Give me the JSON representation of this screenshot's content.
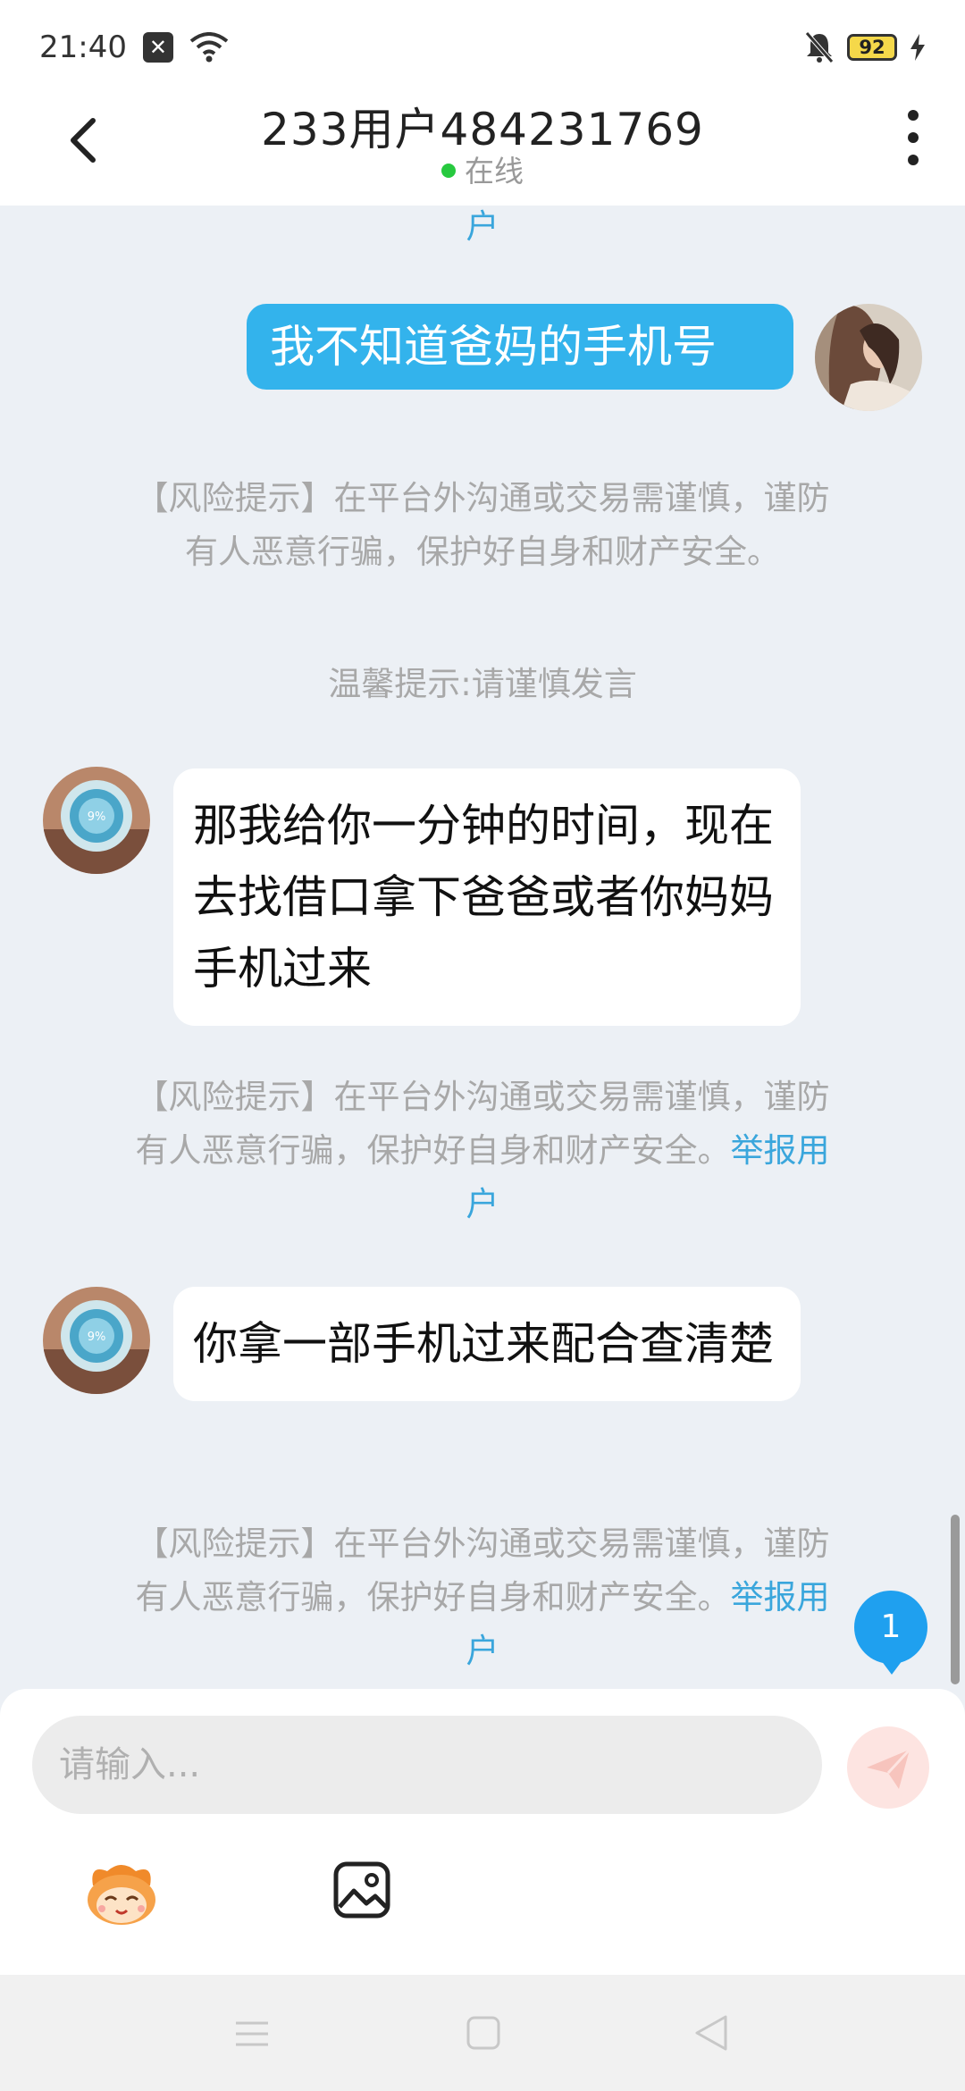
{
  "status_bar": {
    "time": "21:40",
    "battery": "92",
    "icons": [
      "close-box-icon",
      "wifi-icon",
      "mute-bell-icon",
      "battery-icon",
      "charging-icon"
    ]
  },
  "header": {
    "title": "233用户484231769",
    "status": "在线",
    "status_color": "#27c93f"
  },
  "chat": {
    "top_fragment": "户",
    "messages": [
      {
        "sender": "me",
        "text": "我不知道爸妈的手机号"
      },
      {
        "sender": "other",
        "text": "那我给你一分钟的时间，现在去找借口拿下爸爸或者你妈妈手机过来"
      },
      {
        "sender": "other",
        "text": "你拿一部手机过来配合查清楚"
      }
    ],
    "risk_notice_line1": "【风险提示】在平台外沟通或交易需谨慎，谨防",
    "risk_notice_line2": "有人恶意行骗，保护好自身和财产安全。",
    "report_link_part1": "举报用",
    "report_link_part2": "户",
    "warm_tip": "温馨提示:请谨慎发言",
    "unread_count": "1"
  },
  "input": {
    "placeholder": "请输入..."
  },
  "colors": {
    "accent": "#33b3ec",
    "link": "#3aa6dc",
    "background": "#ecf0f5",
    "send_button": "#fde4e1"
  }
}
